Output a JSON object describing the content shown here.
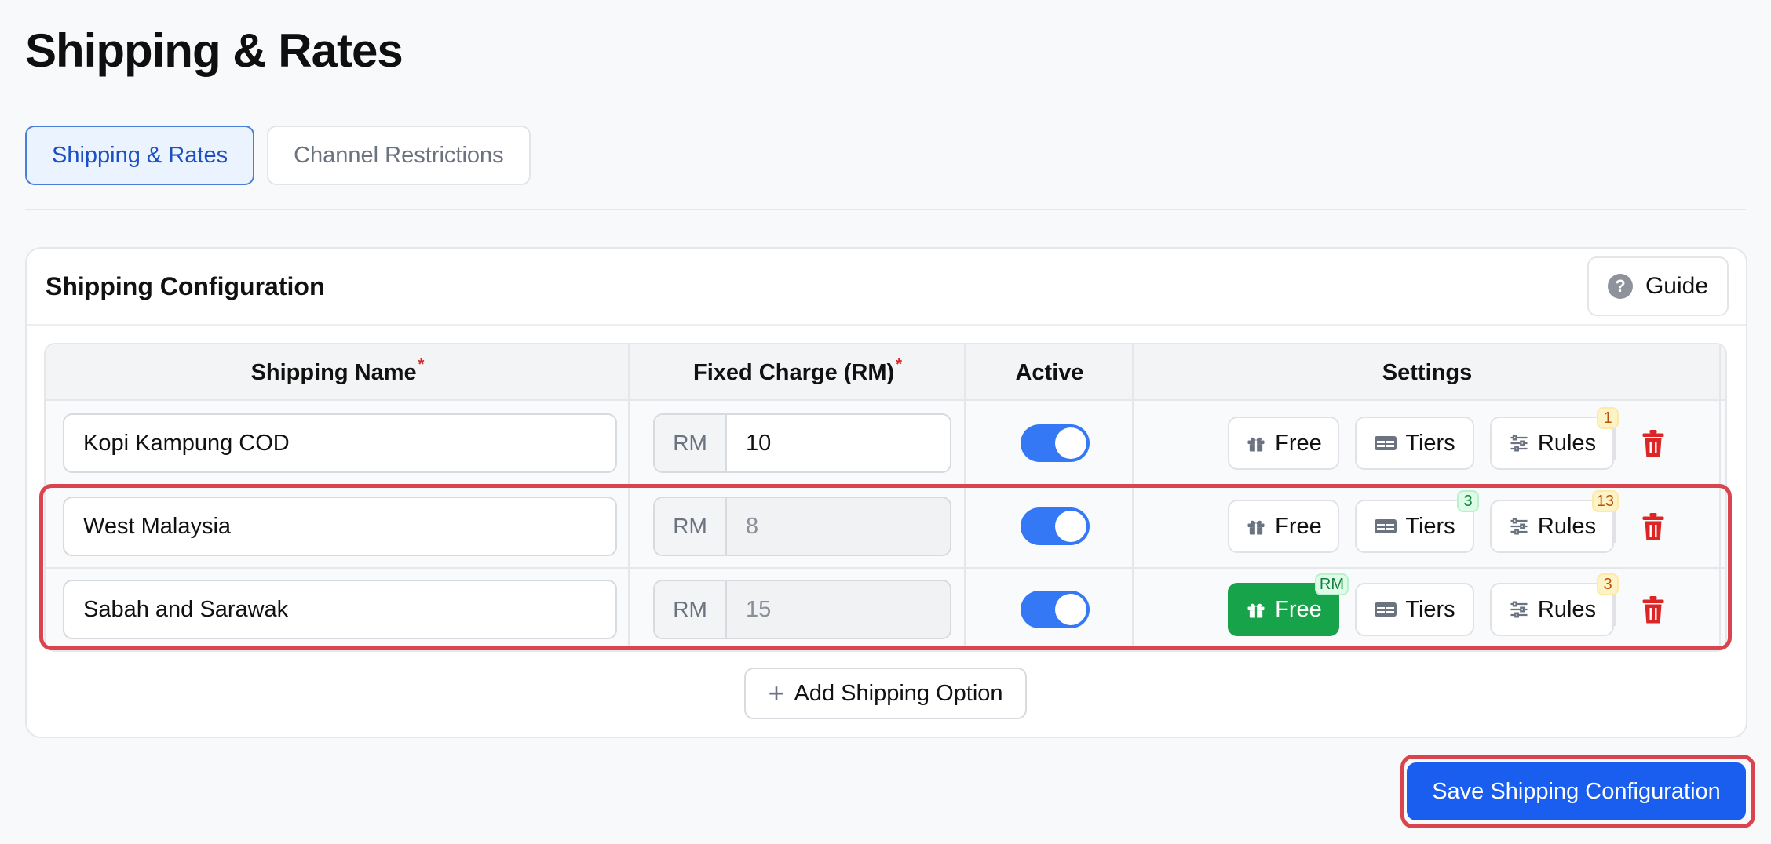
{
  "page": {
    "title": "Shipping & Rates"
  },
  "tabs": [
    {
      "label": "Shipping & Rates",
      "active": true
    },
    {
      "label": "Channel Restrictions",
      "active": false
    }
  ],
  "config": {
    "title": "Shipping Configuration",
    "guide_label": "Guide",
    "columns": {
      "name": "Shipping Name",
      "charge": "Fixed Charge (RM)",
      "active": "Active",
      "settings": "Settings",
      "required_mark": "*"
    },
    "rows": [
      {
        "name": "Kopi Kampung COD",
        "currency": "RM",
        "charge": "10",
        "active": true,
        "free_label": "Free",
        "tiers_label": "Tiers",
        "rules_label": "Rules",
        "free_badge": "",
        "tiers_badge": "",
        "rules_badge": "1"
      },
      {
        "name": "West Malaysia",
        "currency": "RM",
        "charge": "8",
        "active": true,
        "free_label": "Free",
        "tiers_label": "Tiers",
        "rules_label": "Rules",
        "free_badge": "",
        "tiers_badge": "3",
        "rules_badge": "13"
      },
      {
        "name": "Sabah and Sarawak",
        "currency": "RM",
        "charge": "15",
        "active": true,
        "free_label": "Free",
        "tiers_label": "Tiers",
        "rules_label": "Rules",
        "free_badge": "RM",
        "tiers_badge": "",
        "rules_badge": "3"
      }
    ],
    "add_label": "Add Shipping Option"
  },
  "save_label": "Save Shipping Configuration",
  "colors": {
    "primary": "#1a5ef0",
    "toggle": "#3478f6",
    "free_active": "#16a34a",
    "danger": "#dc2626",
    "highlight": "#d9444f"
  },
  "icons": {
    "gift": "gift-icon",
    "tiers": "table-icon",
    "rules": "sliders-icon",
    "delete": "trash-icon",
    "guide": "question-icon",
    "add": "plus-icon"
  }
}
